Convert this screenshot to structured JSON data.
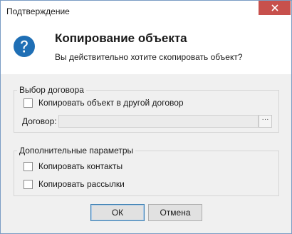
{
  "window": {
    "title": "Подтверждение"
  },
  "header": {
    "heading": "Копирование объекта",
    "message": "Вы действительно хотите скопировать объект?",
    "icon": "question-icon"
  },
  "contract_group": {
    "legend": "Выбор договора",
    "copy_to_other_label": "Копировать объект в другой договор",
    "copy_to_other_checked": false,
    "contract_label": "Договор:",
    "contract_value": "",
    "browse_label": "···"
  },
  "extra_group": {
    "legend": "Дополнительные параметры",
    "copy_contacts_label": "Копировать контакты",
    "copy_contacts_checked": false,
    "copy_mailings_label": "Копировать рассылки",
    "copy_mailings_checked": false
  },
  "buttons": {
    "ok_label": "ОК",
    "cancel_label": "Отмена"
  },
  "colors": {
    "close_button": "#c7504c",
    "icon_blue": "#1f6fb5",
    "default_button_border": "#3c7fb1"
  }
}
